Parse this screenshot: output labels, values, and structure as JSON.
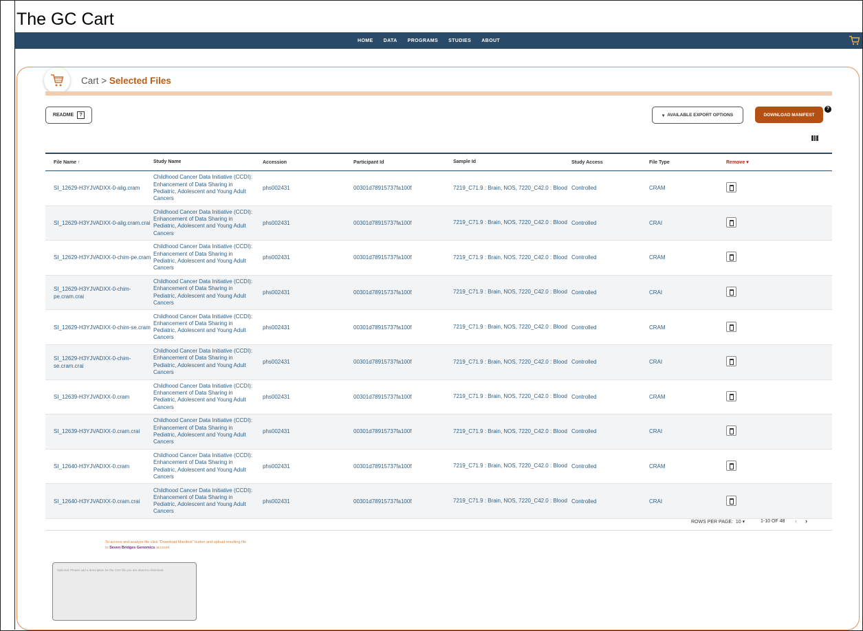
{
  "caption": "The GC Cart",
  "nav": {
    "links": [
      "HOME",
      "DATA",
      "PROGRAMS",
      "STUDIES",
      "ABOUT"
    ]
  },
  "header": {
    "crumb": "Cart > ",
    "title": "Selected Files"
  },
  "buttons": {
    "readme": "README",
    "readme_icon": "?",
    "export": "AVAILABLE EXPORT OPTIONS",
    "download": "DOWNLOAD MANIFEST"
  },
  "table": {
    "columns": [
      "File Name",
      "Study Name",
      "Accession",
      "Participant Id",
      "Sample Id",
      "Study Access",
      "File Type",
      "Remove"
    ],
    "rows": [
      [
        "SI_12629-H3YJVADXX-0-alig.cram",
        "Childhood Cancer Data Initiative (CCDI): Enhancement of Data Sharing in Pediatric, Adolescent and Young Adult Cancers",
        "phs002431",
        "00301d78915737fa100f",
        "7219_C71.9 : Brain, NOS, 7220_C42.0 : Blood",
        "Controlled",
        "CRAM"
      ],
      [
        "SI_12629-H3YJVADXX-0-alig.cram.crai",
        "Childhood Cancer Data Initiative (CCDI): Enhancement of Data Sharing in Pediatric, Adolescent and Young Adult Cancers",
        "phs002431",
        "00301d78915737fa100f",
        "7219_C71.9 : Brain, NOS, 7220_C42.0 : Blood",
        "Controlled",
        "CRAI"
      ],
      [
        "SI_12629-H3YJVADXX-0-chim-pe.cram",
        "Childhood Cancer Data Initiative (CCDI): Enhancement of Data Sharing in Pediatric, Adolescent and Young Adult Cancers",
        "phs002431",
        "00301d78915737fa100f",
        "7219_C71.9 : Brain, NOS, 7220_C42.0 : Blood",
        "Controlled",
        "CRAM"
      ],
      [
        "SI_12629-H3YJVADXX-0-chim-pe.cram.crai",
        "Childhood Cancer Data Initiative (CCDI): Enhancement of Data Sharing in Pediatric, Adolescent and Young Adult Cancers",
        "phs002431",
        "00301d78915737fa100f",
        "7219_C71.9 : Brain, NOS, 7220_C42.0 : Blood",
        "Controlled",
        "CRAI"
      ],
      [
        "SI_12629-H3YJVADXX-0-chim-se.cram",
        "Childhood Cancer Data Initiative (CCDI): Enhancement of Data Sharing in Pediatric, Adolescent and Young Adult Cancers",
        "phs002431",
        "00301d78915737fa100f",
        "7219_C71.9 : Brain, NOS, 7220_C42.0 : Blood",
        "Controlled",
        "CRAM"
      ],
      [
        "SI_12629-H3YJVADXX-0-chim-se.cram.crai",
        "Childhood Cancer Data Initiative (CCDI): Enhancement of Data Sharing in Pediatric, Adolescent and Young Adult Cancers",
        "phs002431",
        "00301d78915737fa100f",
        "7219_C71.9 : Brain, NOS, 7220_C42.0 : Blood",
        "Controlled",
        "CRAI"
      ],
      [
        "SI_12639-H3YJVADXX-0.cram",
        "Childhood Cancer Data Initiative (CCDI): Enhancement of Data Sharing in Pediatric, Adolescent and Young Adult Cancers",
        "phs002431",
        "00301d78915737fa100f",
        "7219_C71.9 : Brain, NOS, 7220_C42.0 : Blood",
        "Controlled",
        "CRAM"
      ],
      [
        "SI_12639-H3YJVADXX-0.cram.crai",
        "Childhood Cancer Data Initiative (CCDI): Enhancement of Data Sharing in Pediatric, Adolescent and Young Adult Cancers",
        "phs002431",
        "00301d78915737fa100f",
        "7219_C71.9 : Brain, NOS, 7220_C42.0 : Blood",
        "Controlled",
        "CRAI"
      ],
      [
        "SI_12640-H3YJVADXX-0.cram",
        "Childhood Cancer Data Initiative (CCDI): Enhancement of Data Sharing in Pediatric, Adolescent and Young Adult Cancers",
        "phs002431",
        "00301d78915737fa100f",
        "7219_C71.9 : Brain, NOS, 7220_C42.0 : Blood",
        "Controlled",
        "CRAM"
      ],
      [
        "SI_12640-H3YJVADXX-0.cram.crai",
        "Childhood Cancer Data Initiative (CCDI): Enhancement of Data Sharing in Pediatric, Adolescent and Young Adult Cancers",
        "phs002431",
        "00301d78915737fa100f",
        "7219_C71.9 : Brain, NOS, 7220_C42.0 : Blood",
        "Controlled",
        "CRAI"
      ]
    ]
  },
  "pagination": {
    "rows_label": "ROWS PER PAGE:",
    "rows_value": "10",
    "range": "1-10 OF 48"
  },
  "note": {
    "line1": "To access and analyze file click \"Download Manifest\" button and upload resulting file",
    "line2_prefix": "to ",
    "link": "Seven Bridges Genomics",
    "line2_suffix": " account"
  },
  "description": {
    "placeholder": "Optional: Please add a description for the CSV file you are about to download."
  },
  "colors": {
    "nav": "#2a4a6a",
    "accent": "#b65012",
    "link": "#2d5f86",
    "border": "#e7905a"
  }
}
